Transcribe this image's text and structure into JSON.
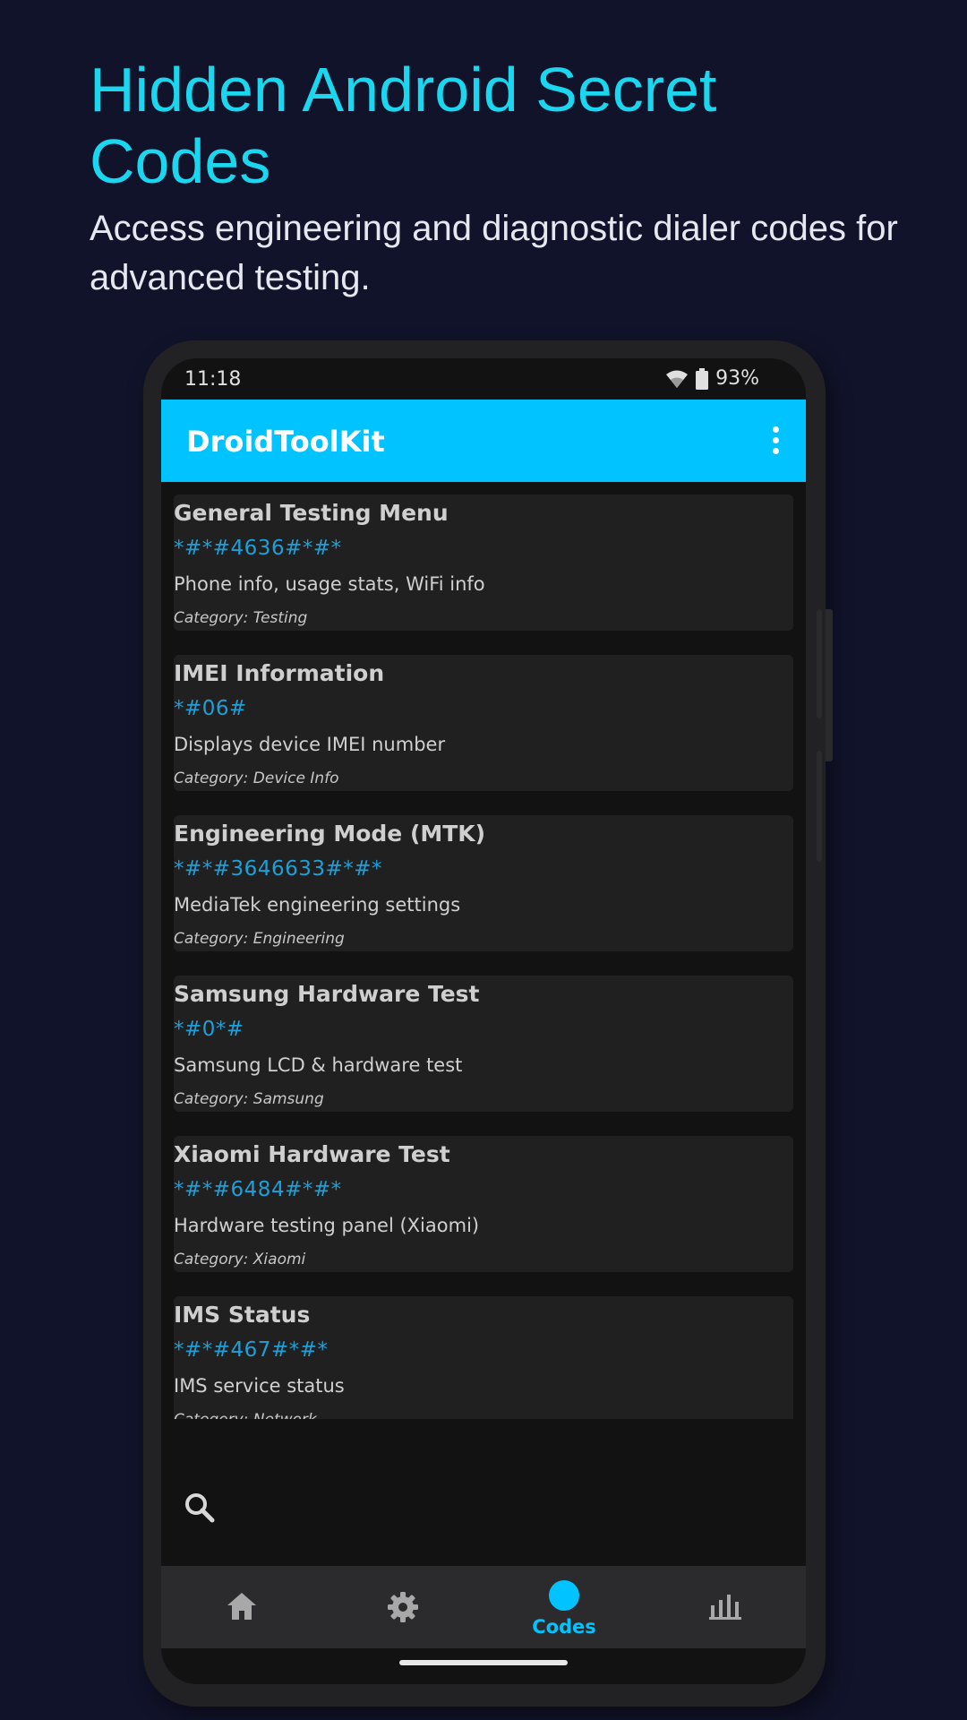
{
  "promo": {
    "title": "Hidden Android Secret Codes",
    "subtitle": "Access engineering and diagnostic dialer codes for advanced testing."
  },
  "status_bar": {
    "time": "11:18",
    "battery": "93%",
    "icons": [
      "wifi-icon",
      "battery-icon"
    ]
  },
  "app_bar": {
    "title": "DroidToolKit",
    "menu_icon": "more-vert-icon"
  },
  "codes": [
    {
      "name": "General Testing Menu",
      "code": "*#*#4636#*#*",
      "description": "Phone info, usage stats, WiFi info",
      "category": "Category: Testing"
    },
    {
      "name": "IMEI Information",
      "code": "*#06#",
      "description": "Displays device IMEI number",
      "category": "Category: Device Info"
    },
    {
      "name": "Engineering Mode (MTK)",
      "code": "*#*#3646633#*#*",
      "description": "MediaTek engineering settings",
      "category": "Category: Engineering"
    },
    {
      "name": "Samsung Hardware Test",
      "code": "*#0*#",
      "description": "Samsung LCD & hardware test",
      "category": "Category: Samsung"
    },
    {
      "name": "Xiaomi Hardware Test",
      "code": "*#*#6484#*#*",
      "description": "Hardware testing panel (Xiaomi)",
      "category": "Category: Xiaomi"
    },
    {
      "name": "IMS Status",
      "code": "*#*#467#*#*",
      "description": "IMS service status",
      "category": "Category: Network"
    }
  ],
  "search": {
    "icon": "search-icon"
  },
  "bottom_nav": {
    "items": [
      {
        "icon": "home-icon",
        "label": ""
      },
      {
        "icon": "settings-icon",
        "label": ""
      },
      {
        "icon": "codes-icon",
        "label": "Codes",
        "active": true
      },
      {
        "icon": "bar-chart-icon",
        "label": ""
      }
    ]
  },
  "colors": {
    "background": "#11132a",
    "accent": "#00c3ff",
    "title": "#1ad6ee",
    "code_text": "#1f9fd8",
    "card": "#202020"
  }
}
